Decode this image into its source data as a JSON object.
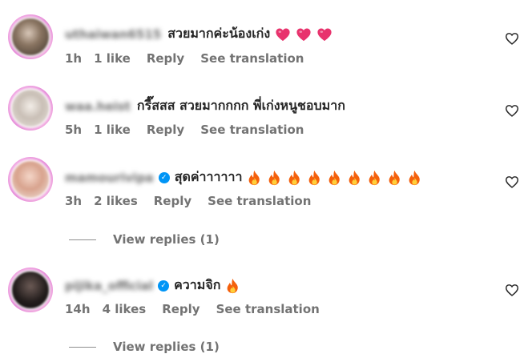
{
  "comments": [
    {
      "username": "uthaiwan6515",
      "text": "สวยมากค่ะน้องเก่ง",
      "emoji": "heart",
      "emoji_count": 3,
      "time": "1h",
      "likes": "1 like",
      "reply_label": "Reply",
      "translate_label": "See translation",
      "verified": false
    },
    {
      "username": "waa.heist",
      "text": "กรี๊สสส สวยมากกกก พี่เก่งหนูชอบมาก",
      "emoji": "",
      "emoji_count": 0,
      "time": "5h",
      "likes": "1 like",
      "reply_label": "Reply",
      "translate_label": "See translation",
      "verified": false
    },
    {
      "username": "mamourivipa",
      "text": "สุดค่าาาาาา",
      "emoji": "fire",
      "emoji_count": 9,
      "time": "3h",
      "likes": "2 likes",
      "reply_label": "Reply",
      "translate_label": "See translation",
      "verified": true,
      "view_replies": "View replies (1)"
    },
    {
      "username": "pijika_official",
      "text": "ความจิก",
      "emoji": "fire",
      "emoji_count": 1,
      "time": "14h",
      "likes": "4 likes",
      "reply_label": "Reply",
      "translate_label": "See translation",
      "verified": true,
      "view_replies": "View replies (1)"
    }
  ],
  "colors": {
    "text": "#262626",
    "meta": "#737373",
    "verified": "#0095f6",
    "heart": "#e8336d",
    "fire": "#f4600c",
    "story_ring": "#e58ad8"
  },
  "icons": {
    "like": "heart-outline-icon",
    "verified": "verified-badge-icon"
  }
}
